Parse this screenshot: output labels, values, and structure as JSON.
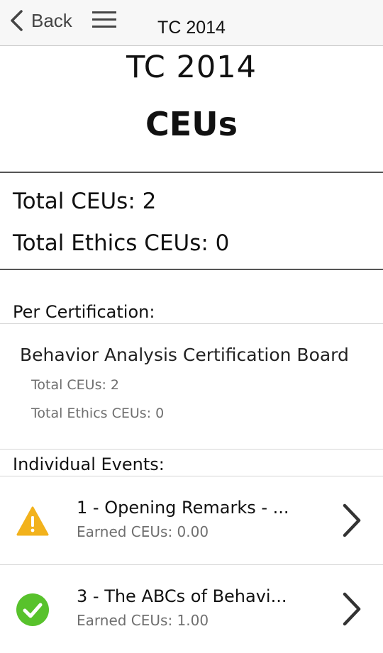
{
  "nav": {
    "back_label": "Back",
    "title": "TC 2014"
  },
  "header": {
    "subtitle": "TC 2014",
    "title": "CEUs"
  },
  "totals": {
    "ceus": "Total CEUs: 2",
    "ethics": "Total Ethics CEUs: 0"
  },
  "per_certification": {
    "label": "Per Certification:",
    "board": "Behavior Analysis Certification Board",
    "total_ceus": "Total CEUs: 2",
    "total_ethics": "Total Ethics CEUs: 0"
  },
  "events": {
    "label": "Individual Events:",
    "items": [
      {
        "title": "1 - Opening Remarks - ...",
        "earned": "Earned CEUs: 0.00",
        "status": "warning-icon",
        "color": "#f2b21c"
      },
      {
        "title": "3 - The ABCs of Behavi...",
        "earned": "Earned CEUs: 1.00",
        "status": "check-circle-icon",
        "color": "#58c22c"
      }
    ]
  }
}
